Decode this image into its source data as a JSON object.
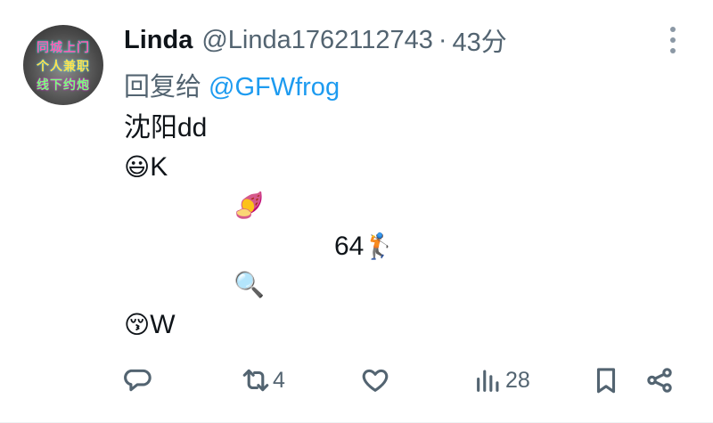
{
  "avatar": {
    "lines": [
      "同城上门",
      "个人兼职",
      "线下约炮"
    ]
  },
  "user": {
    "name": "Linda",
    "handle": "@Linda1762112743",
    "separator": "·",
    "time": "43分"
  },
  "reply": {
    "prefix": "回复给",
    "mention": "@GFWfrog"
  },
  "content": {
    "line1": "沈阳dd",
    "line2_emoji": "😃",
    "line2_text": "K",
    "line3_emoji": "🍠",
    "line4_text": "64",
    "line4_emoji": "🏌",
    "line5_emoji": "🔍",
    "line6_emoji": "😚",
    "line6_text": "W"
  },
  "actions": {
    "reply_count": "",
    "retweet_count": "4",
    "like_count": "",
    "views_count": "28"
  },
  "icons": [
    "more-icon",
    "reply-icon",
    "retweet-icon",
    "like-icon",
    "views-icon",
    "bookmark-icon",
    "share-icon"
  ],
  "colors": {
    "link": "#1d9bf0",
    "muted": "#536471",
    "text": "#0f1419"
  }
}
